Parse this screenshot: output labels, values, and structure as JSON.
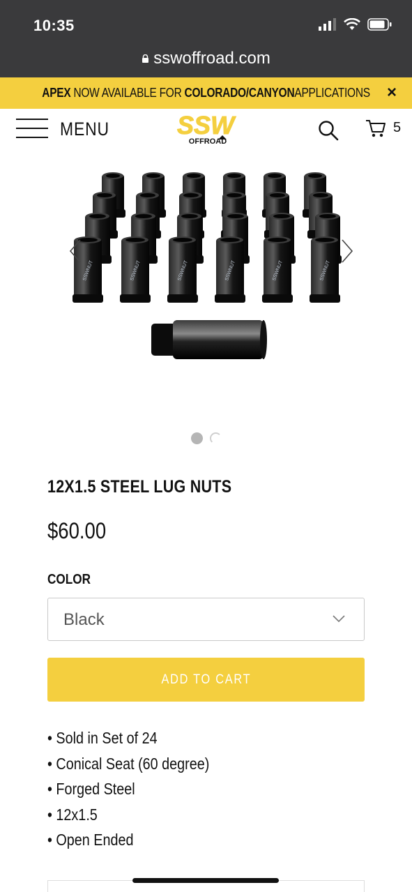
{
  "status_bar": {
    "time": "10:35"
  },
  "browser": {
    "url": "sswoffroad.com"
  },
  "promo": {
    "part1_bold": "APEX",
    "part2": " NOW AVAILABLE FOR ",
    "part3_bold": "COLORADO/CANYON",
    "part4": "APPLICATIONS",
    "close": "×"
  },
  "header": {
    "menu_label": "MENU",
    "logo_main": "SSW",
    "logo_sub": "OFFROAD",
    "cart_count": "5"
  },
  "gallery": {
    "slide_count": 2,
    "active_slide": 1,
    "lug_label": "SSWNUT"
  },
  "product": {
    "title": "12X1.5 STEEL LUG NUTS",
    "price": "$60.00",
    "color_label": "COLOR",
    "color_value": "Black",
    "add_to_cart": "ADD TO CART",
    "features": [
      "• Sold in Set of 24",
      "• Conical Seat (60 degree)",
      "• Forged Steel",
      "• 12x1.5",
      "• Open Ended"
    ]
  },
  "colors": {
    "accent_yellow": "#f4cf3f",
    "status_bar_bg": "#3a3a3c",
    "button_text": "#ffffff"
  }
}
